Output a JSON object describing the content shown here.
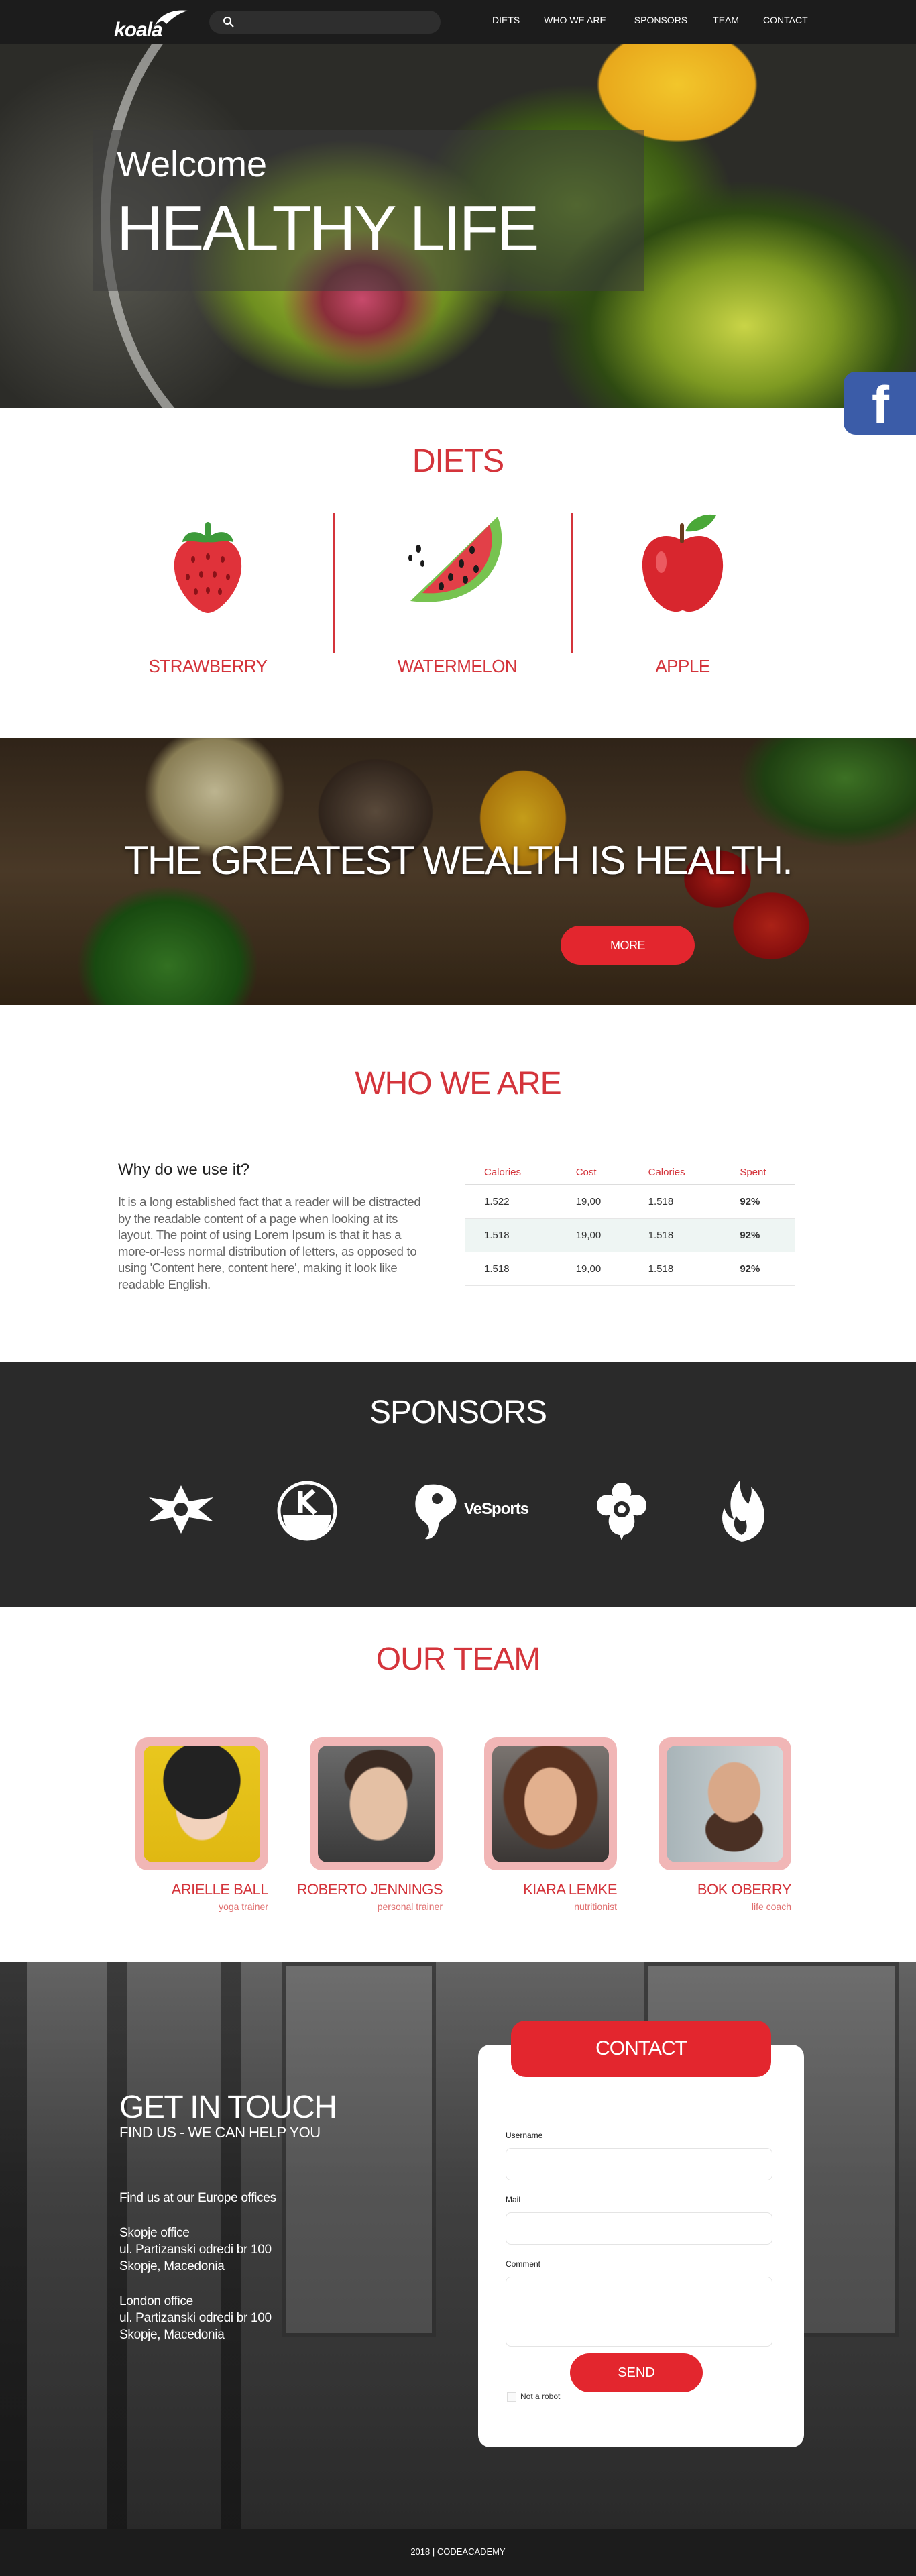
{
  "header": {
    "logo_text": "koala",
    "search_placeholder": "",
    "nav": [
      "DIETS",
      "WHO WE ARE",
      "SPONSORS",
      "TEAM",
      "CONTACT"
    ]
  },
  "hero": {
    "welcome": "Welcome",
    "headline": "HEALTHY LIFE"
  },
  "facebook_icon": "f",
  "diets": {
    "title": "DIETS",
    "items": [
      {
        "label": "STRAWBERRY",
        "icon": "strawberry-icon"
      },
      {
        "label": "WATERMELON",
        "icon": "watermelon-icon"
      },
      {
        "label": "APPLE",
        "icon": "apple-icon"
      }
    ]
  },
  "banner": {
    "quote": "THE GREATEST WEALTH IS HEALTH.",
    "button": "MORE"
  },
  "who": {
    "title": "WHO WE ARE",
    "subtitle": "Why do we use it?",
    "paragraph": "It is a long established fact that a reader will be distracted by the readable content of a page when looking at its layout. The point of using Lorem Ipsum is that it has a more-or-less normal distribution of letters, as opposed to using 'Content here, content here', making it look like readable English.",
    "table": {
      "headers": [
        "Calories",
        "Cost",
        "Calories",
        "Spent"
      ],
      "rows": [
        [
          "1.522",
          "19,00",
          "1.518",
          "92%"
        ],
        [
          "1.518",
          "19,00",
          "1.518",
          "92%"
        ],
        [
          "1.518",
          "19,00",
          "1.518",
          "92%"
        ]
      ]
    }
  },
  "sponsors": {
    "title": "SPONSORS",
    "brand_text": "VeSports"
  },
  "team": {
    "title": "OUR TEAM",
    "members": [
      {
        "name": "ARIELLE BALL",
        "role": "yoga trainer"
      },
      {
        "name": "ROBERTO JENNINGS",
        "role": "personal trainer"
      },
      {
        "name": "KIARA LEMKE",
        "role": "nutritionist"
      },
      {
        "name": "BOK OBERRY",
        "role": "life coach"
      }
    ]
  },
  "contact": {
    "title": "GET IN TOUCH",
    "subtitle": "FIND US - WE CAN HELP YOU",
    "offices_heading": "Find us at our Europe offices",
    "office1": [
      "Skopje office",
      "ul. Partizanski odredi br 100",
      "Skopje, Macedonia"
    ],
    "office2": [
      "London office",
      "ul. Partizanski odredi br 100",
      "Skopje, Macedonia"
    ],
    "form": {
      "header_button": "CONTACT",
      "username_label": "Username",
      "mail_label": "Mail",
      "comment_label": "Comment",
      "send_button": "SEND",
      "robot_label": "Not a robot"
    }
  },
  "footer": {
    "text": "2018 | CODEACADEMY"
  },
  "colors": {
    "accent": "#d4343b",
    "button": "#e3262e",
    "dark": "#1c1c1c",
    "sponsors_bg": "#2a2a2a",
    "facebook": "#3b5ca8"
  }
}
